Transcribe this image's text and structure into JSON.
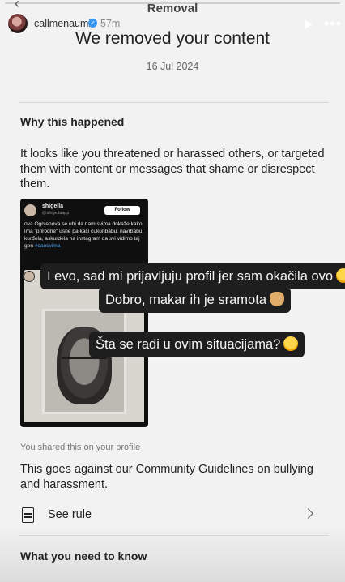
{
  "story": {
    "username": "callmenaumi",
    "time_ago": "57m",
    "screen_title": "Removal"
  },
  "notice": {
    "title": "We removed your content",
    "date": "16 Jul 2024",
    "why_heading": "Why this happened",
    "why_text": "It looks like you threatened or harassed others, or targeted them with content or messages that shame or disrespect them.",
    "shared_note": "You shared this on your profile",
    "guidelines_text": "This goes against our Community Guidelines on bullying and harassment.",
    "see_rule_label": "See rule",
    "know_heading": "What you need to know"
  },
  "embedded_post": {
    "username": "shigella",
    "handle": "@shigellaapp",
    "follow_label": "Follow",
    "caption": "ova Ognjenova se ubi da nam svima dokaže kako ima \"prirodne\" usne pa kači čukunbabu, navrbabu, kurđela, askurdela na instagram da svi vidimo taj gen",
    "hashtag": "#caosvima"
  },
  "overlay_texts": [
    {
      "text": "I evo, sad mi prijavljuju profil jer sam okačila ovo",
      "emoji": "laughing-emoji"
    },
    {
      "text": "Dobro, makar ih je sramota",
      "emoji": "ok-hand-emoji"
    },
    {
      "text": "Šta se radi u ovim situacijama?",
      "emoji": "laughing-emoji"
    }
  ],
  "colors": {
    "background": "#f2f2f2",
    "bubble": "#1e1e1e",
    "verified": "#3897f0",
    "hashtag": "#4aa3ff"
  }
}
